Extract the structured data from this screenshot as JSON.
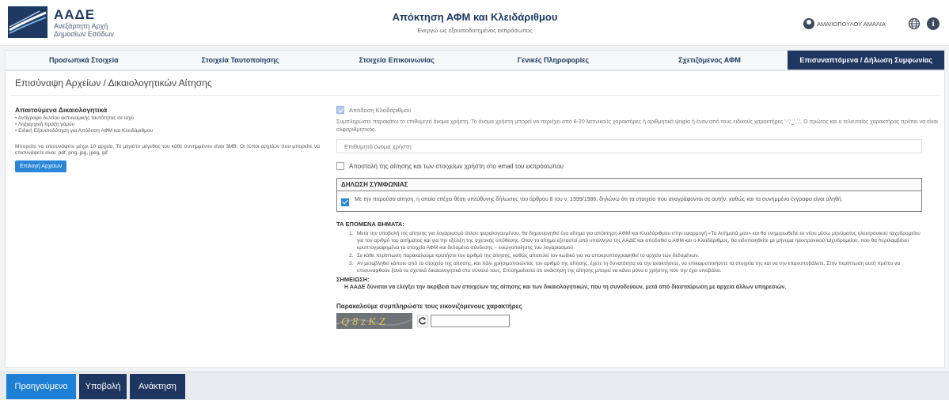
{
  "header": {
    "brand_title": "ΑΑΔΕ",
    "brand_sub_1": "Ανεξάρτητη Αρχή",
    "brand_sub_2": "Δημοσίων Εσόδων",
    "app_title": "Απόκτηση ΑΦΜ και Κλειδάριθμου",
    "app_subtitle": "Ενεργώ ως εξουσιοδοτημένος εκπρόσωπος",
    "user_name": "ΑΜΑ/ΙΟΠΟΥΛΟΥ ΑΜΑΛΙΑ",
    "icons": {
      "user": "user-avatar-icon",
      "globe": "globe-icon",
      "info": "info-icon"
    }
  },
  "tabs": [
    {
      "label": "Προσωπικά Στοιχεία",
      "active": false
    },
    {
      "label": "Στοιχεία Ταυτοποίησης",
      "active": false
    },
    {
      "label": "Στοιχεία Επικοινωνίας",
      "active": false
    },
    {
      "label": "Γενικές Πληροφορίες",
      "active": false
    },
    {
      "label": "Σχετιζόμενος ΑΦΜ",
      "active": false
    },
    {
      "label": "Επισυναπτόμενα / Δήλωση Συμφωνίας",
      "active": true
    }
  ],
  "main": {
    "section_title": "Επισύναψη Αρχείων / Δικαιολογητικών Αίτησης",
    "required": {
      "title": "Απαιτούμενα Δικαιολογητικά",
      "items": [
        "Αντίγραφο δελτίου αστυνομικής ταυτότητας σε ισχύ",
        "Ληξιαρχική πράξη γάμου",
        "Ειδική Εξουσιοδότηση για Απόδοση ΑΦΜ και Κλειδάριθμου"
      ],
      "upload_note": "Μπορείτε να επισυνάψετε μέχρι 10 αρχεία. Το μέγιστο μέγεθος του κάθε συνημμένου είναι 3MB. Οι τύποι αρχείων που μπορείτε να επισυνάψετε είναι: pdf, png, jpg, jpeg, gif",
      "choose_files_label": "Επιλογή Αρχείων"
    },
    "credentials": {
      "assign_label": "Απόδοση Κλειδάριθμου",
      "assign_checked": true,
      "help_text": "Συμπληρώστε παρακάτω το επιθυμητό όνομα χρήστη. Το όνομα χρήστη μπορεί να περιέχει από 8-20 λατινικούς χαρακτήρες ή αριθμητικά ψηφία ή έναν από τους ειδικούς χαρακτήρες '-','_','.'. Ο πρώτος και ο τελευταίος χαρακτήρας πρέπει να είναι αλφαριθμητικός.",
      "username_placeholder": "Επιθυμητό όνομα χρήστη",
      "email_label": "Αποστολή της αίτησης και των στοιχείων χρήστη στο email του εκπρόσωπου",
      "email_checked": false
    },
    "agreement": {
      "title": "ΔΗΛΩΣΗ ΣΥΜΦΩΝΙΑΣ",
      "text": "Με την παρούσα αίτηση, η οποία επέχει θέση υπεύθυνης δήλωσης του άρθρου 8 του ν. 1599/1986, δηλώνω ότι τα στοιχεία που αναγράφονται σε αυτήν, καθώς και τα συνημμένα έγγραφα είναι αληθή.",
      "checked": true
    },
    "next_steps": {
      "title": "ΤΑ ΕΠΟΜΕΝΑ ΒΗΜΑΤΑ:",
      "items": [
        {
          "num": "1.",
          "text": "Μετά την υποβολή της αίτησης για λογαριασμό άλλου φορολογουμένου, θα δημιουργηθεί ένα αίτημα για απόκτηση ΑΦΜ και Κλειδάριθμου στην εφαρμογή «Τα Αιτήματά μου» και θα ενημερωθείτε εκ νέου μέσω μηνύματος ηλεκτρονικού ταχυδρομείου για τον αριθμό του αιτήματος και για την εξέλιξη της σχετικής υπόθεσης. Όταν το αίτημα εξεταστεί από υπάλληλο της ΑΑΔΕ και αποδοθεί ο ΑΦΜ και ο Κλειδάριθμος, θα ειδοποιηθείτε με μήνυμα ηλεκτρονικού ταχυδρομείου, που θα περιλαμβάνει κρυπτογραφημένα τα στοιχεία ΑΦΜ και δεδομένα σύνδεσης – ενεργοποίησης του λογαριασμού."
        },
        {
          "num": "2.",
          "text": "Σε κάθε περίπτωση παρακαλούμε κρατήστε τον αριθμό της αίτησης, καθώς αποτελεί τον κωδικό για να αποκρυπτογραφηθεί το αρχείο των δεδομένων."
        },
        {
          "num": "3.",
          "text": "Αν μεταβληθεί κάποιο από τα στοιχεία της αίτησης, και πάλι χρησιμοποιώντας τον αριθμό της αίτησης, έχετε τη δυνατότητα να την ανακτήσετε, να επικαιροποιήσετε τα στοιχεία της και να την επανυποβάλετε. Στην περίπτωση αυτή πρέπει να επισυναφθούν ξανά τα σχετικά δικαιολογητικά στο σύνολό τους. Επισημαίνεται ότι ανάκτηση της αίτησης μπορεί να κάνει μόνο ο χρήστης που την έχει υποβάλει."
        }
      ]
    },
    "note": {
      "title": "ΣΗΜΕΙΩΣΗ:",
      "text": "Η ΑΑΔΕ δύναται να ελέγξει την ακρίβεια των στοιχείων της αίτησης και των δικαιολογητικών, που τη συνοδεύουν, μετά από διασταύρωση με αρχεία άλλων υπηρεσιών."
    },
    "captcha": {
      "title": "Παρακαλούμε συμπληρώστε τους εικονιζόμενους χαρακτήρες",
      "image_text": "Q8zKZ",
      "input_value": ""
    }
  },
  "footer": {
    "prev_label": "Προηγούμενο",
    "submit_label": "Υποβολή",
    "recover_label": "Ανάκτηση"
  }
}
